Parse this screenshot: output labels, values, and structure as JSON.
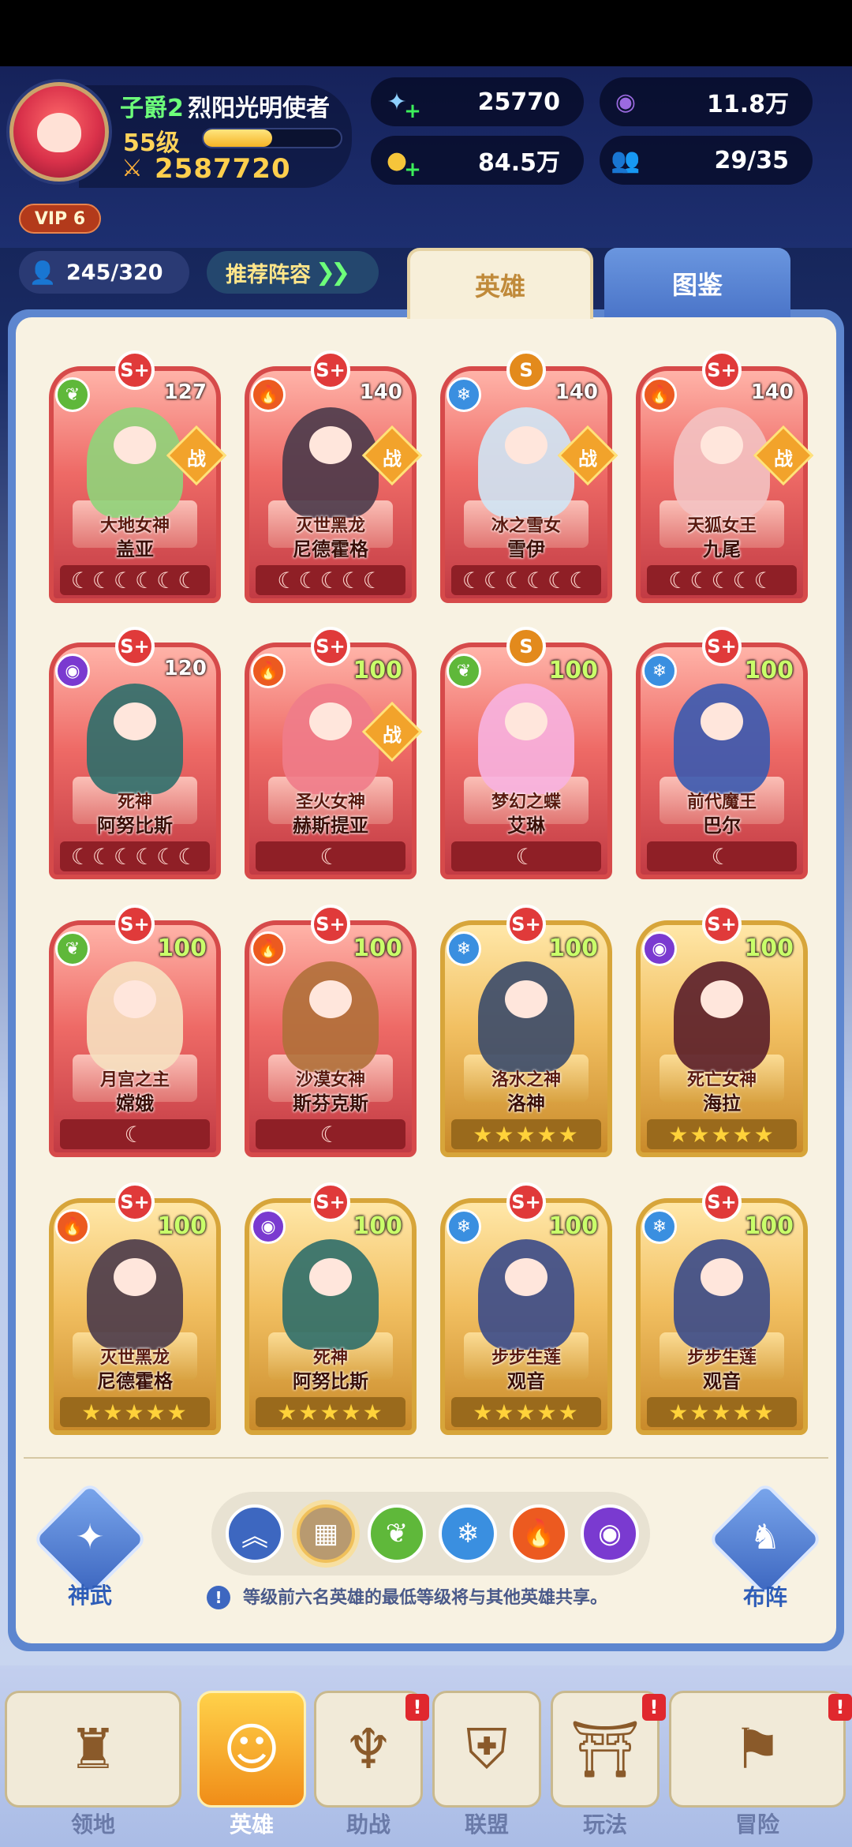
{
  "player": {
    "rank": "子爵2",
    "name": "烈阳光明使者",
    "level": "55级",
    "power": "2587720",
    "vip": "VIP 6",
    "exp_progress": 0.5
  },
  "resources": [
    {
      "id": "diamond",
      "icon": "star-gem-icon",
      "value": "25770",
      "has_plus": true,
      "color": "#8ed0ff"
    },
    {
      "id": "purple-currency",
      "icon": "purple-orb-icon",
      "value": "11.8万",
      "has_plus": false,
      "color": "#9b6ae0"
    },
    {
      "id": "gold",
      "icon": "gold-coin-icon",
      "value": "84.5万",
      "has_plus": true,
      "color": "#f6c53a"
    },
    {
      "id": "friends",
      "icon": "people-icon",
      "value": "29/35",
      "has_plus": false,
      "color": "#ffffff"
    }
  ],
  "hero_count": "245/320",
  "recommend_label": "推荐阵容",
  "tabs": {
    "hero": "英雄",
    "codex": "图鉴"
  },
  "heroes": [
    {
      "title": "大地女神",
      "name": "盖亚",
      "level": "127",
      "grade": "S+",
      "element": "nature",
      "stars": "☾☾☾☾☾☾",
      "tier": "red",
      "battle": true,
      "art": "#8fd47a"
    },
    {
      "title": "灭世黑龙",
      "name": "尼德霍格",
      "level": "140",
      "grade": "S+",
      "element": "fire",
      "stars": "☾☾☾☾☾",
      "tier": "red",
      "battle": true,
      "art": "#4a3a4a"
    },
    {
      "title": "冰之雪女",
      "name": "雪伊",
      "level": "140",
      "grade": "S",
      "element": "ice",
      "stars": "☾☾☾☾☾☾",
      "tier": "red",
      "battle": true,
      "art": "#cfe6f5"
    },
    {
      "title": "天狐女王",
      "name": "九尾",
      "level": "140",
      "grade": "S+",
      "element": "fire",
      "stars": "☾☾☾☾☾",
      "tier": "red",
      "battle": true,
      "art": "#f3c2c2"
    },
    {
      "title": "死神",
      "name": "阿努比斯",
      "level": "120",
      "grade": "S+",
      "element": "dark",
      "stars": "☾☾☾☾☾☾",
      "tier": "red",
      "battle": false,
      "art": "#2e6e6a"
    },
    {
      "title": "圣火女神",
      "name": "赫斯提亚",
      "level": "100",
      "grade": "S+",
      "element": "fire",
      "stars": "☾",
      "tier": "red",
      "battle": true,
      "art": "#f07c8a"
    },
    {
      "title": "梦幻之蝶",
      "name": "艾琳",
      "level": "100",
      "grade": "S",
      "element": "nature",
      "stars": "☾",
      "tier": "red",
      "battle": false,
      "art": "#f7b2e0"
    },
    {
      "title": "前代魔王",
      "name": "巴尔",
      "level": "100",
      "grade": "S+",
      "element": "ice",
      "stars": "☾",
      "tier": "red",
      "battle": false,
      "art": "#3a5ab0"
    },
    {
      "title": "月宫之主",
      "name": "嫦娥",
      "level": "100",
      "grade": "S+",
      "element": "nature",
      "stars": "☾",
      "tier": "red",
      "battle": false,
      "art": "#f6e0c0"
    },
    {
      "title": "沙漠女神",
      "name": "斯芬克斯",
      "level": "100",
      "grade": "S+",
      "element": "fire",
      "stars": "☾",
      "tier": "red",
      "battle": false,
      "art": "#b0703a"
    },
    {
      "title": "洛水之神",
      "name": "洛神",
      "level": "100",
      "grade": "S+",
      "element": "ice",
      "stars": "★★★★★",
      "tier": "gold",
      "battle": false,
      "art": "#3a4a6a"
    },
    {
      "title": "死亡女神",
      "name": "海拉",
      "level": "100",
      "grade": "S+",
      "element": "dark",
      "stars": "★★★★★",
      "tier": "gold",
      "battle": false,
      "art": "#5a1e2a"
    },
    {
      "title": "灭世黑龙",
      "name": "尼德霍格",
      "level": "100",
      "grade": "S+",
      "element": "fire",
      "stars": "★★★★★",
      "tier": "gold",
      "battle": false,
      "art": "#4a3a4a"
    },
    {
      "title": "死神",
      "name": "阿努比斯",
      "level": "100",
      "grade": "S+",
      "element": "dark",
      "stars": "★★★★★",
      "tier": "gold",
      "battle": false,
      "art": "#2e6e6a"
    },
    {
      "title": "步步生莲",
      "name": "观音",
      "level": "100",
      "grade": "S+",
      "element": "ice",
      "stars": "★★★★★",
      "tier": "gold",
      "battle": false,
      "art": "#3a4a8a"
    },
    {
      "title": "步步生莲",
      "name": "观音",
      "level": "100",
      "grade": "S+",
      "element": "ice",
      "stars": "★★★★★",
      "tier": "gold",
      "battle": false,
      "art": "#3a4a8a"
    }
  ],
  "battle_label": "战",
  "side": {
    "left_label": "神武",
    "right_label": "布阵"
  },
  "filters": [
    {
      "id": "upgrade",
      "icon": "double-chevron-up-icon",
      "color": "#3d67c0",
      "active": false
    },
    {
      "id": "all",
      "icon": "grid-icon",
      "color": "#b89a70",
      "active": true
    },
    {
      "id": "nature",
      "icon": "leaf-icon",
      "color": "#5fb83a",
      "active": false
    },
    {
      "id": "ice",
      "icon": "snowflake-icon",
      "color": "#3a8fe0",
      "active": false
    },
    {
      "id": "fire",
      "icon": "flame-icon",
      "color": "#ec5a20",
      "active": false
    },
    {
      "id": "dark",
      "icon": "eye-icon",
      "color": "#7a3ad0",
      "active": false
    }
  ],
  "info_text": "等级前六名英雄的最低等级将与其他英雄共享。",
  "nav": [
    {
      "label": "领地",
      "icon": "castle-icon",
      "active": false,
      "badge": ""
    },
    {
      "label": "英雄",
      "icon": "hero-face-icon",
      "active": true,
      "badge": ""
    },
    {
      "label": "助战",
      "icon": "support-icon",
      "active": false,
      "badge": "!"
    },
    {
      "label": "联盟",
      "icon": "shield-icon",
      "active": false,
      "badge": ""
    },
    {
      "label": "玩法",
      "icon": "gate-icon",
      "active": false,
      "badge": "!"
    },
    {
      "label": "冒险",
      "icon": "flag-icon",
      "active": false,
      "badge": "!"
    }
  ]
}
